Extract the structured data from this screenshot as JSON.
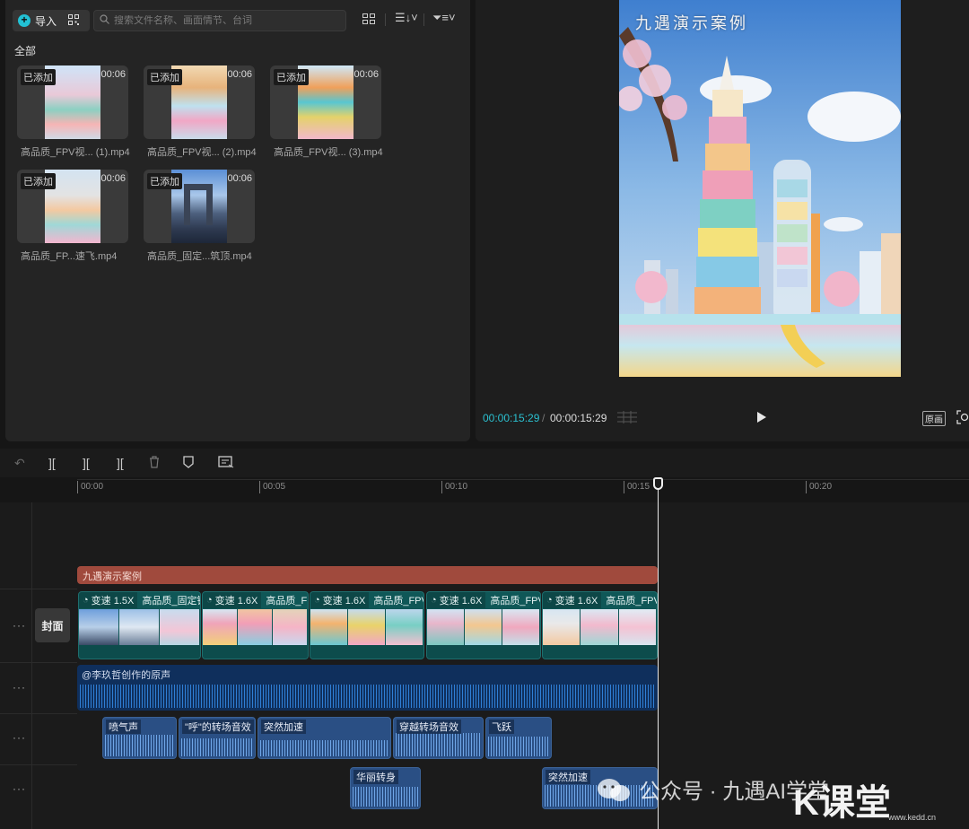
{
  "media_panel": {
    "import_label": "导入",
    "search_placeholder": "搜索文件名称、画面情节、台词",
    "section_label": "全部",
    "items": [
      {
        "badge": "已添加",
        "duration": "00:06",
        "name": "高品质_FPV视... (1).mp4"
      },
      {
        "badge": "已添加",
        "duration": "00:06",
        "name": "高品质_FPV视... (2).mp4"
      },
      {
        "badge": "已添加",
        "duration": "00:06",
        "name": "高品质_FPV视... (3).mp4"
      },
      {
        "badge": "已添加",
        "duration": "00:06",
        "name": "高品质_FP...速飞.mp4"
      },
      {
        "badge": "已添加",
        "duration": "00:06",
        "name": "高品质_固定...筑顶.mp4"
      }
    ]
  },
  "preview": {
    "overlay_title": "九遇演示案例",
    "current_time": "00:00:15:29",
    "separator": "/",
    "total_time": "00:00:15:29",
    "original_label": "原画"
  },
  "timeline": {
    "ruler": [
      "00:00",
      "00:05",
      "00:10",
      "00:15",
      "00:20"
    ],
    "cover_label": "封面",
    "title_clip": "九遇演示案例",
    "video_clips": [
      {
        "speed": "变速 1.5X",
        "name": "高品质_固定镜头"
      },
      {
        "speed": "变速 1.6X",
        "name": "高品质_FPV"
      },
      {
        "speed": "变速 1.6X",
        "name": "高品质_FPV"
      },
      {
        "speed": "变速 1.6X",
        "name": "高品质_FPV"
      },
      {
        "speed": "变速 1.6X",
        "name": "高品质_FPV"
      }
    ],
    "voice_label": "@李玖哲创作的原声",
    "sfx_row1": [
      "喷气声",
      "\"呼\"的转场音效",
      "突然加速",
      "穿越转场音效",
      "飞跃"
    ],
    "sfx_row2": [
      "华丽转身",
      "突然加速"
    ]
  },
  "watermark": {
    "text": "公众号 · 九遇AI学堂",
    "logo": "K课堂",
    "url": "www.kedd.cn"
  }
}
